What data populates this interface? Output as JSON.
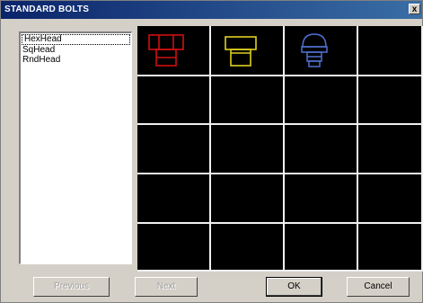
{
  "window": {
    "title": "STANDARD BOLTS",
    "close_glyph": "x"
  },
  "list": {
    "items": [
      {
        "label": "HexHead",
        "selected": true
      },
      {
        "label": "SqHead",
        "selected": false
      },
      {
        "label": "RndHead",
        "selected": false
      }
    ]
  },
  "previews": [
    {
      "name": "HexHead",
      "color": "#d01010"
    },
    {
      "name": "SqHead",
      "color": "#e0d020"
    },
    {
      "name": "RndHead",
      "color": "#5070d0"
    }
  ],
  "buttons": {
    "previous": "Previous",
    "next": "Next",
    "ok": "OK",
    "cancel": "Cancel"
  }
}
